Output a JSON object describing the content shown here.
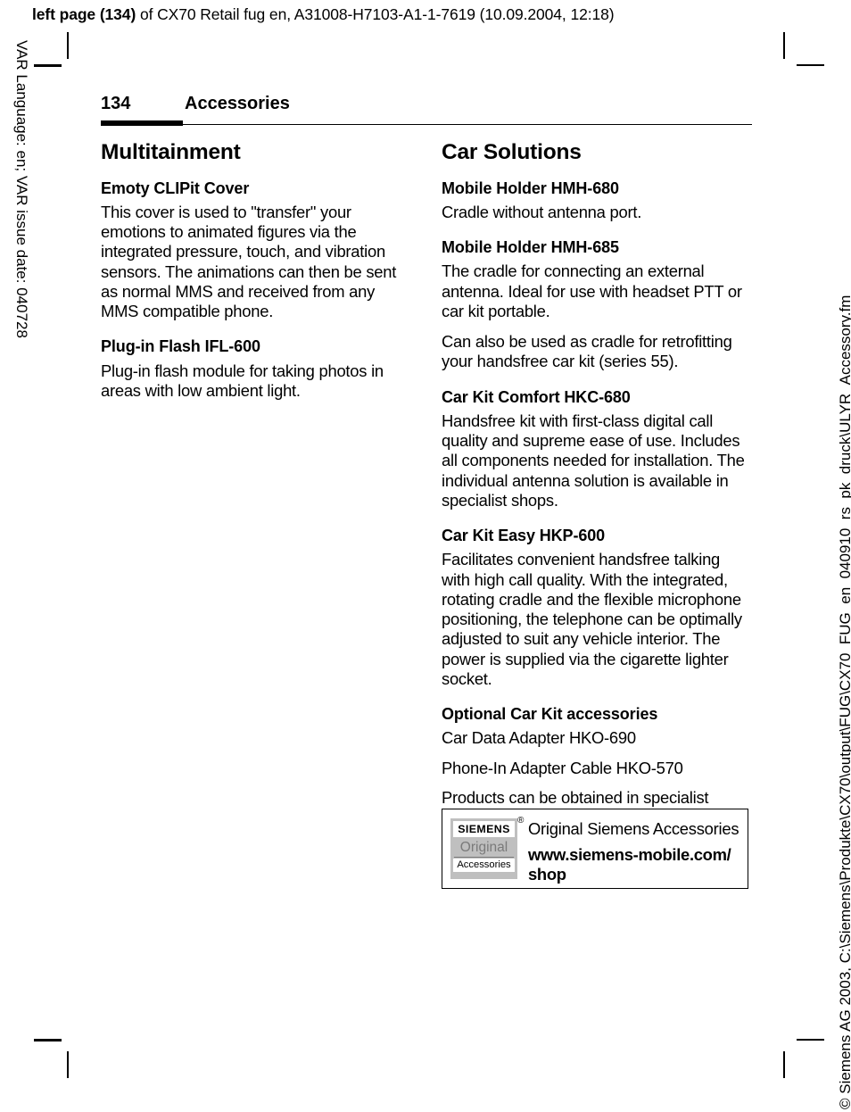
{
  "running_head": {
    "bold_prefix": "left page (134)",
    "rest": " of CX70 Retail fug en, A31008-H7103-A1-1-7619 (10.09.2004, 12:18)"
  },
  "margins": {
    "left_text": "VAR Language: en; VAR issue date: 040728",
    "right_text": "© Siemens AG 2003, C:\\Siemens\\Produkte\\CX70\\output\\FUG\\CX70_FUG_en_040910_rs_pk_druck\\ULYR_Accessory.fm"
  },
  "header": {
    "page_number": "134",
    "chapter": "Accessories"
  },
  "left_column": {
    "section_title": "Multitainment",
    "blocks": [
      {
        "heading": "Emoty CLIPit Cover",
        "paragraphs": [
          "This cover is used to \"transfer\" your emotions to animated figures via the integrated pressure, touch, and vibration sensors. The animations can then be sent as normal MMS and received from any MMS compatible phone."
        ]
      },
      {
        "heading": "Plug-in Flash IFL-600",
        "paragraphs": [
          "Plug-in flash module for taking photos in areas with low ambient light."
        ]
      }
    ]
  },
  "right_column": {
    "section_title": "Car Solutions",
    "blocks": [
      {
        "heading": "Mobile Holder HMH-680",
        "paragraphs": [
          "Cradle without antenna port."
        ]
      },
      {
        "heading": "Mobile Holder HMH-685",
        "paragraphs": [
          "The cradle for connecting an external antenna. Ideal for use with headset PTT or car kit portable.",
          "Can also be used as cradle for retrofitting your handsfree car kit (series 55)."
        ]
      },
      {
        "heading": "Car Kit Comfort HKC-680",
        "paragraphs": [
          "Handsfree kit with first-class digital call quality and supreme ease of use. Includes all components needed for installation. The individual antenna solution is available in specialist shops."
        ]
      },
      {
        "heading": "Car Kit Easy HKP-600",
        "paragraphs": [
          "Facilitates convenient handsfree talking with high call quality. With the integrated, rotating cradle and the flexible microphone positioning, the telephone can be optimally adjusted to suit any vehicle interior. The power is supplied via the cigarette lighter socket."
        ]
      },
      {
        "heading": "Optional Car Kit accessories",
        "paragraphs": [
          "Car Data Adapter HKO-690",
          "Phone-In Adapter Cable HKO-570",
          "Products can be obtained in specialist shops or you can visit the Siemens Mobile Store online:"
        ]
      }
    ]
  },
  "accessories_box": {
    "logo_brand": "SIEMENS",
    "logo_original": "Original",
    "logo_accessories": "Accessories",
    "registered_mark": "®",
    "line1": "Original Siemens Accessories",
    "line2": "www.siemens-mobile.com/ shop"
  }
}
